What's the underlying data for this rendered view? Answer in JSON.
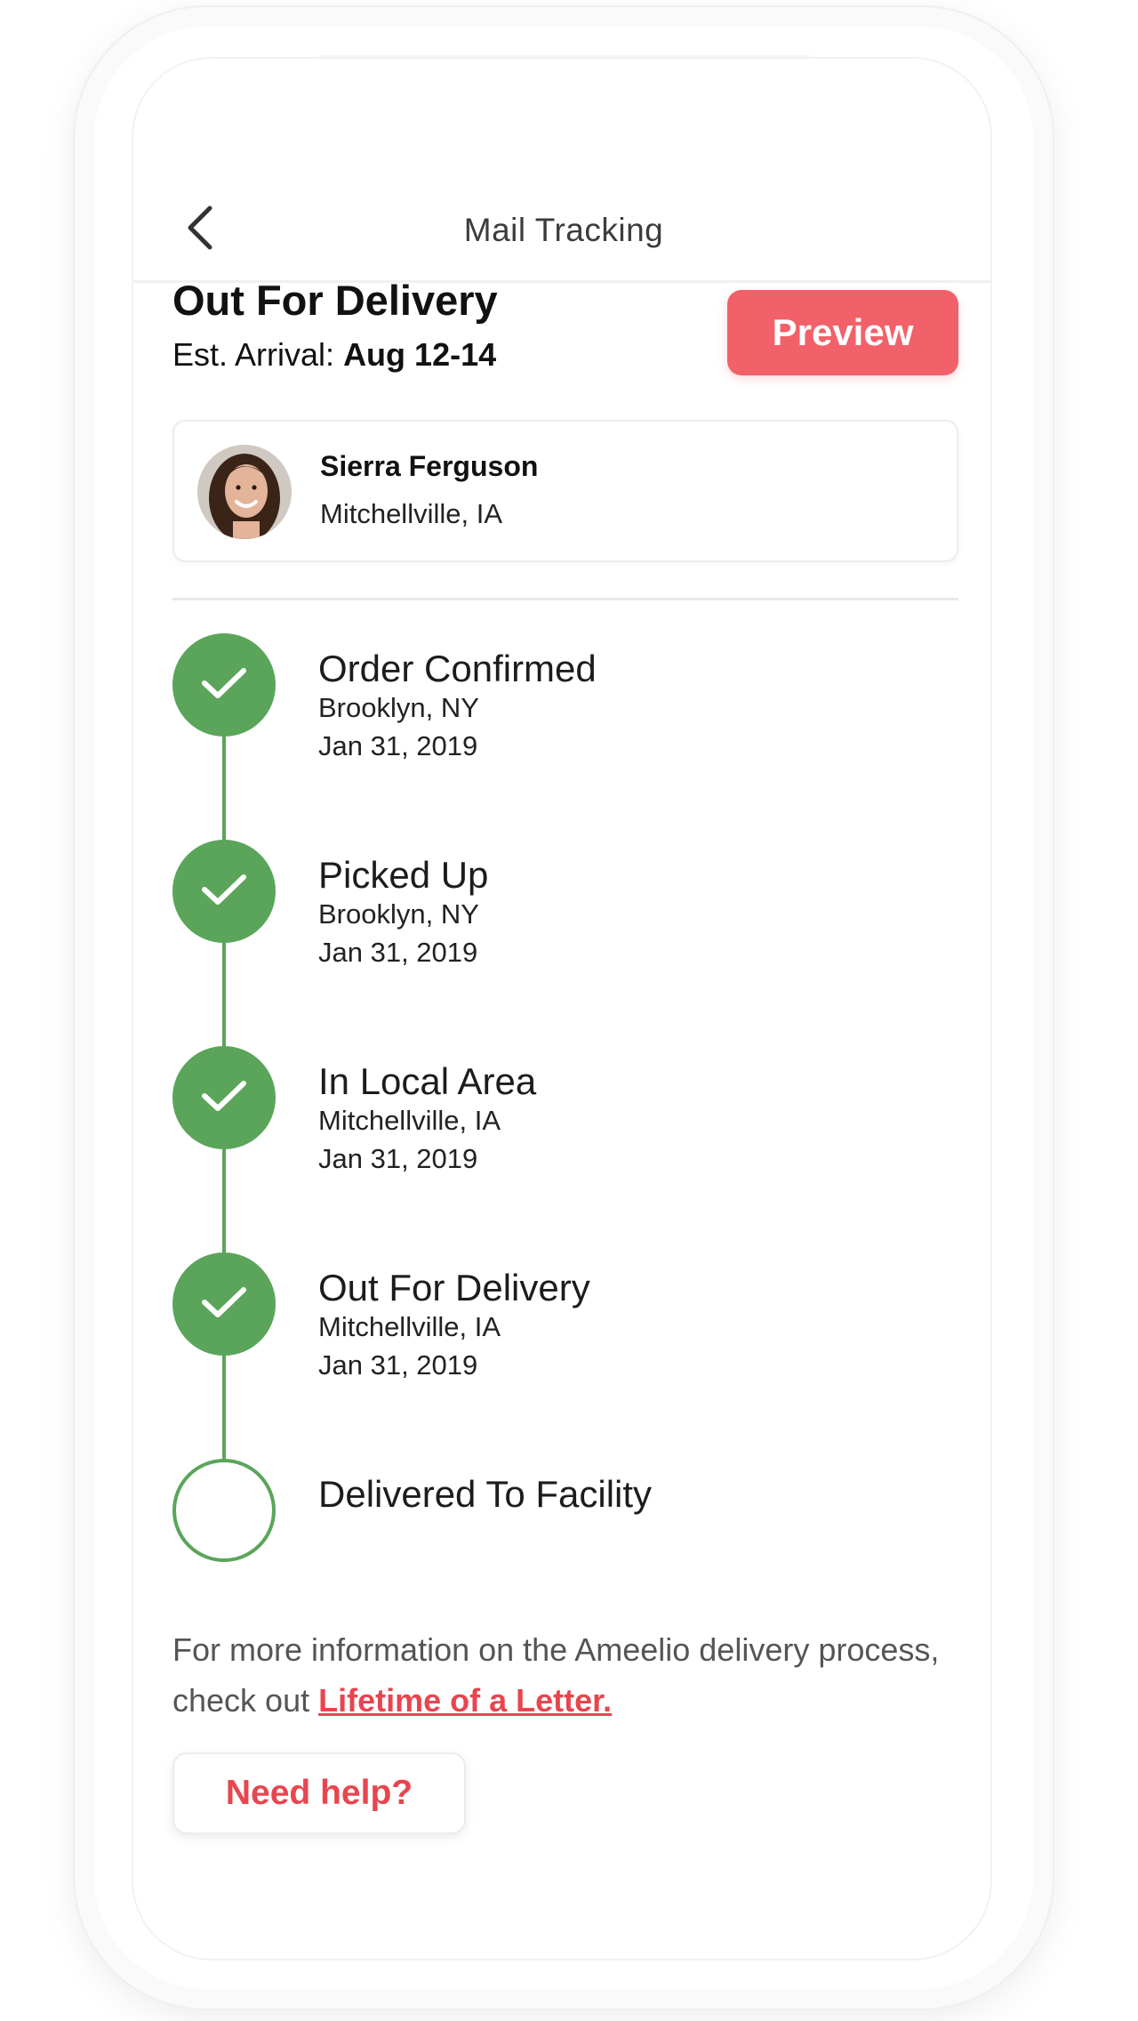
{
  "header": {
    "title": "Mail Tracking",
    "back_icon": "chevron-left-icon"
  },
  "status": {
    "title": "Out For Delivery",
    "arrival_label": "Est. Arrival:",
    "arrival_value": "Aug 12-14",
    "preview_label": "Preview"
  },
  "recipient": {
    "name": "Sierra Ferguson",
    "location": "Mitchellville, IA"
  },
  "timeline": [
    {
      "title": "Order Confirmed",
      "location": "Brooklyn, NY",
      "date": "Jan 31, 2019",
      "status": "done"
    },
    {
      "title": "Picked Up",
      "location": "Brooklyn, NY",
      "date": "Jan 31, 2019",
      "status": "done"
    },
    {
      "title": "In Local Area",
      "location": "Mitchellville, IA",
      "date": "Jan 31, 2019",
      "status": "done"
    },
    {
      "title": "Out For Delivery",
      "location": "Mitchellville, IA",
      "date": "Jan 31, 2019",
      "status": "done"
    },
    {
      "title": "Delivered To Facility",
      "status": "pending"
    }
  ],
  "info": {
    "text": "For more information on the Ameelio delivery process, check out ",
    "link": "Lifetime of a Letter."
  },
  "help_label": "Need help?",
  "colors": {
    "accent_red": "#f2616a",
    "link_red": "#e8454f",
    "success_green": "#5aa55a"
  }
}
